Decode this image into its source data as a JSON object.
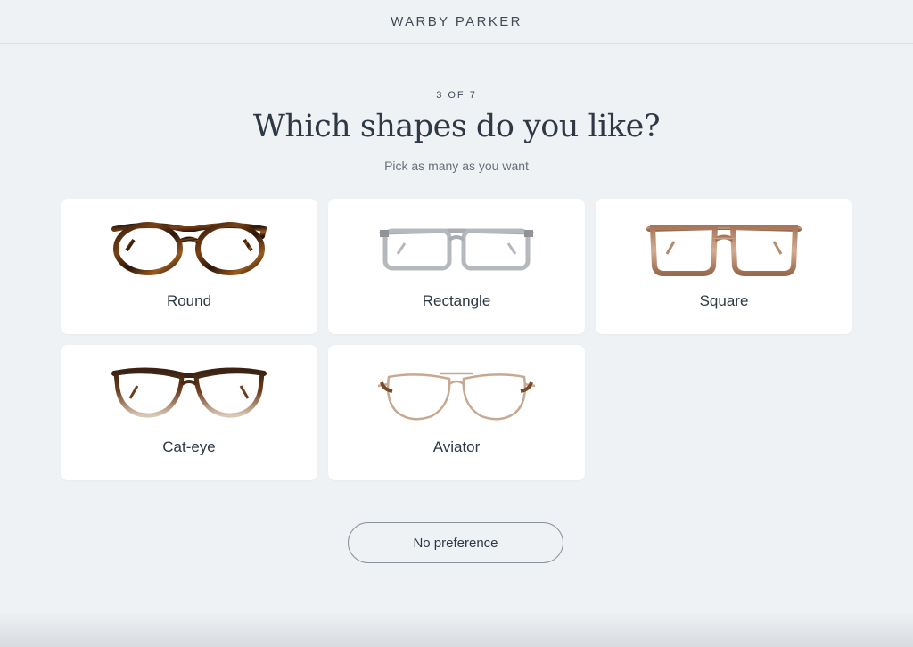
{
  "header": {
    "brand": "WARBY PARKER"
  },
  "quiz": {
    "step": "3 OF 7",
    "title": "Which shapes do you like?",
    "subtitle": "Pick as many as you want",
    "options": [
      {
        "label": "Round",
        "icon": "round-glasses-icon"
      },
      {
        "label": "Rectangle",
        "icon": "rectangle-glasses-icon"
      },
      {
        "label": "Square",
        "icon": "square-glasses-icon"
      },
      {
        "label": "Cat-eye",
        "icon": "cat-eye-glasses-icon"
      },
      {
        "label": "Aviator",
        "icon": "aviator-glasses-icon"
      }
    ],
    "no_preference_label": "No preference"
  },
  "colors": {
    "background": "#eff2f5",
    "card": "#ffffff",
    "text": "#2e3945"
  }
}
